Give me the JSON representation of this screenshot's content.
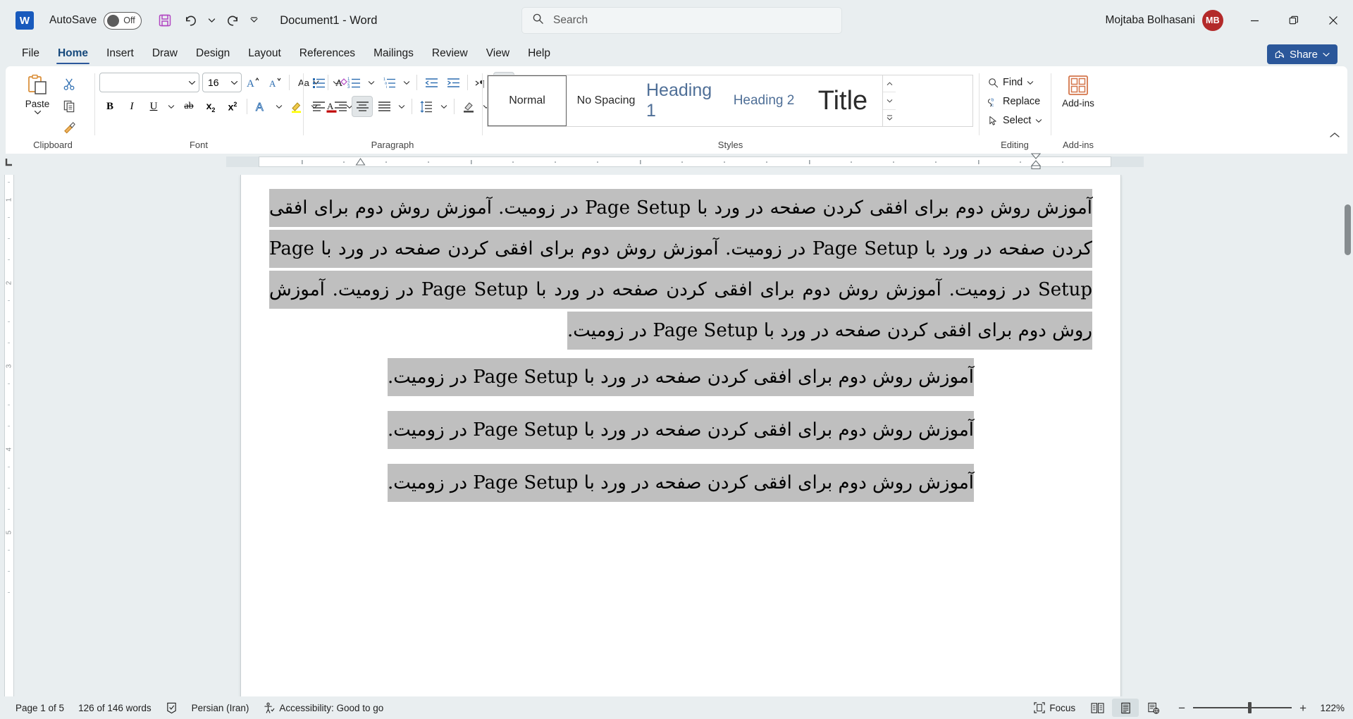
{
  "titlebar": {
    "app_icon": "word-logo",
    "autosave_label": "AutoSave",
    "autosave_state": "Off",
    "save_icon": "save-icon",
    "undo_icon": "undo-icon",
    "redo_icon": "redo-icon",
    "customize_qat_icon": "chevron-down-icon",
    "document_title": "Document1  -  Word",
    "username": "Mojtaba Bolhasani",
    "avatar_initials": "MB",
    "minimize_icon": "minimize-icon",
    "restore_icon": "restore-icon",
    "close_icon": "close-icon"
  },
  "search": {
    "placeholder": "Search",
    "value": "",
    "icon": "search-icon"
  },
  "tabs": [
    {
      "label": "File",
      "active": false
    },
    {
      "label": "Home",
      "active": true
    },
    {
      "label": "Insert",
      "active": false
    },
    {
      "label": "Draw",
      "active": false
    },
    {
      "label": "Design",
      "active": false
    },
    {
      "label": "Layout",
      "active": false
    },
    {
      "label": "References",
      "active": false
    },
    {
      "label": "Mailings",
      "active": false
    },
    {
      "label": "Review",
      "active": false
    },
    {
      "label": "View",
      "active": false
    },
    {
      "label": "Help",
      "active": false
    }
  ],
  "share": {
    "label": "Share",
    "icon": "share-icon",
    "accent": "#2b579a"
  },
  "ribbon": {
    "clipboard": {
      "group_label": "Clipboard",
      "paste_label": "Paste",
      "paste_icon": "paste-icon",
      "cut_icon": "scissors-icon",
      "copy_icon": "copy-icon",
      "format_painter_icon": "format-painter-icon",
      "dialog_launcher_icon": "dialog-launcher-icon"
    },
    "font": {
      "group_label": "Font",
      "font_name": "",
      "font_size": "16",
      "grow_font_icon": "grow-font-icon",
      "shrink_font_icon": "shrink-font-icon",
      "change_case_icon": "change-case-icon",
      "clear_formatting_icon": "clear-formatting-icon",
      "bold_icon": "bold-icon",
      "italic_icon": "italic-icon",
      "underline_icon": "underline-icon",
      "strikethrough_icon": "strikethrough-icon",
      "subscript_icon": "subscript-icon",
      "superscript_icon": "superscript-icon",
      "text_effects_icon": "text-effects-icon",
      "highlight_icon": "text-highlight-icon",
      "font_color_icon": "font-color-icon",
      "highlight_color": "#ffff00",
      "font_color": "#c00000",
      "dialog_launcher_icon": "dialog-launcher-icon"
    },
    "paragraph": {
      "group_label": "Paragraph",
      "bullets_icon": "bullet-list-icon",
      "numbering_icon": "numbered-list-icon",
      "multilevel_icon": "multilevel-list-icon",
      "decrease_indent_icon": "decrease-indent-icon",
      "increase_indent_icon": "increase-indent-icon",
      "ltr_icon": "left-to-right-text-icon",
      "rtl_icon": "right-to-left-text-icon",
      "rtl_active": true,
      "sort_icon": "sort-icon",
      "show_marks_icon": "show-formatting-marks-icon",
      "align_left_icon": "align-left-icon",
      "align_center_icon": "align-center-icon",
      "align_center_active": true,
      "align_right_icon": "align-right-icon",
      "justify_icon": "justify-icon",
      "line_spacing_icon": "line-spacing-icon",
      "shading_icon": "shading-icon",
      "borders_icon": "borders-icon",
      "dialog_launcher_icon": "dialog-launcher-icon"
    },
    "styles": {
      "group_label": "Styles",
      "items": [
        {
          "label": "Normal",
          "selected": true
        },
        {
          "label": "No Spacing",
          "selected": false
        },
        {
          "label": "Heading 1",
          "selected": false
        },
        {
          "label": "Heading 2",
          "selected": false
        },
        {
          "label": "Title",
          "selected": false
        }
      ],
      "scroll_up_icon": "chevron-up-icon",
      "scroll_down_icon": "chevron-down-icon",
      "more_icon": "styles-more-icon",
      "dialog_launcher_icon": "dialog-launcher-icon"
    },
    "editing": {
      "group_label": "Editing",
      "find_label": "Find",
      "find_icon": "search-icon",
      "replace_label": "Replace",
      "replace_icon": "replace-icon",
      "select_label": "Select",
      "select_icon": "cursor-arrow-icon"
    },
    "addins": {
      "group_label": "Add-ins",
      "button_label": "Add-ins",
      "icon": "addins-grid-icon"
    },
    "collapse_icon": "chevron-up-icon"
  },
  "ruler": {
    "tab_stop_icon": "tab-stop-icon",
    "vertical_numbers": [
      "1",
      "2",
      "3",
      "4",
      "5"
    ],
    "left_indent_icon": "indent-marker-icon",
    "right_indent_icon": "indent-marker-icon"
  },
  "document": {
    "paragraph_sentence": "آموزش روش دوم برای افقی کردن صفحه در ورد با Page Setup در زومیت.",
    "paragraph_repeats": 5,
    "centered_lines": [
      "آموزش روش دوم برای افقی کردن صفحه در ورد با Page Setup در زومیت.",
      "آموزش روش دوم برای افقی کردن صفحه در ورد با Page Setup در زومیت.",
      "آموزش روش دوم برای افقی کردن صفحه در ورد با Page Setup در زومیت."
    ],
    "selection_color": "#bfbfbf"
  },
  "statusbar": {
    "page_label": "Page 1 of 5",
    "words_label": "126 of 146 words",
    "proofing_icon": "proofing-icon",
    "language_label": "Persian (Iran)",
    "accessibility_icon": "accessibility-icon",
    "accessibility_label": "Accessibility: Good to go",
    "focus_label": "Focus",
    "focus_icon": "focus-icon",
    "read_mode_icon": "read-mode-icon",
    "print_layout_icon": "print-layout-icon",
    "web_layout_icon": "web-layout-icon",
    "zoom_out_icon": "minus-icon",
    "zoom_in_icon": "plus-icon",
    "zoom_level": "122%"
  }
}
